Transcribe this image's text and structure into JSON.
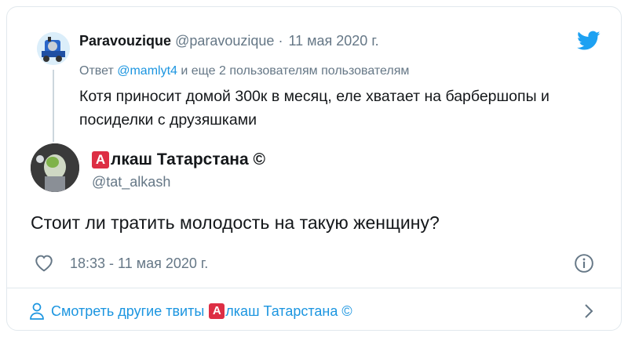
{
  "parent": {
    "name": "Paravouzique",
    "handle": "@paravouzique",
    "sep": "·",
    "date": "11 мая 2020 г.",
    "reply_prefix": "Ответ ",
    "reply_mention": "@mamlyt4",
    "reply_suffix": " и еще 2 пользователям пользователям",
    "text": "Котя приносит домой 300к в месяц, еле хватает на барбершопы и посиделки с друзяшками"
  },
  "main": {
    "badge": "А",
    "name_rest": "лкаш Татарстана ©",
    "handle": "@tat_alkash",
    "text": "Стоит ли тратить молодость на такую женщину?",
    "time": "18:33 - 11 мая 2020 г."
  },
  "footer": {
    "prefix": "Смотреть другие твиты ",
    "badge": "А",
    "name_rest": "лкаш Татарстана ©"
  },
  "colors": {
    "accent": "#1b95e0",
    "secondary_text": "#657786",
    "badge_red": "#dd2e44"
  },
  "icons": [
    "avatar",
    "twitter-bird-icon",
    "heart-icon",
    "info-icon",
    "person-icon",
    "chevron-right-icon"
  ]
}
